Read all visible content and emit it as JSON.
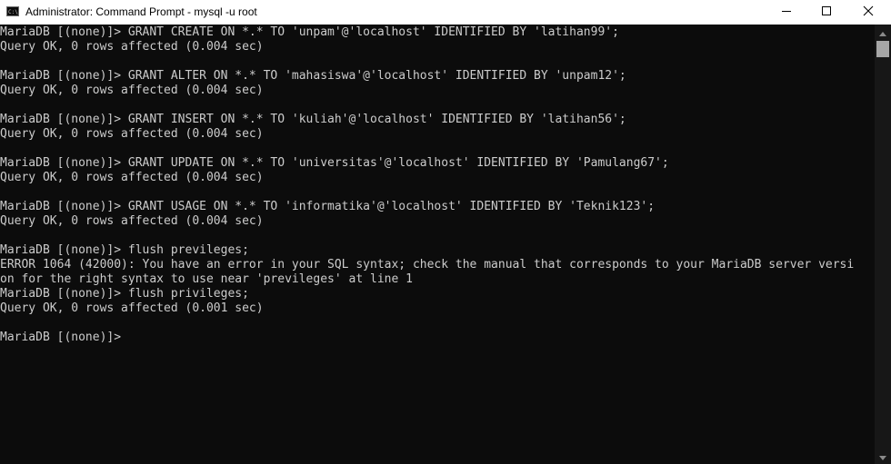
{
  "window": {
    "title": "Administrator: Command Prompt - mysql  -u root",
    "app_icon": "cmd-icon",
    "controls": [
      "minimize-icon",
      "maximize-icon",
      "close-icon"
    ]
  },
  "colors": {
    "console_background": "#0c0c0c",
    "console_text": "#cccccc",
    "titlebar_background": "#ffffff",
    "scrollbar_track": "#171717",
    "scrollbar_thumb": "#a6a6a6"
  },
  "console": {
    "lines": [
      "MariaDB [(none)]> GRANT CREATE ON *.* TO 'unpam'@'localhost' IDENTIFIED BY 'latihan99';",
      "Query OK, 0 rows affected (0.004 sec)",
      "",
      "MariaDB [(none)]> GRANT ALTER ON *.* TO 'mahasiswa'@'localhost' IDENTIFIED BY 'unpam12';",
      "Query OK, 0 rows affected (0.004 sec)",
      "",
      "MariaDB [(none)]> GRANT INSERT ON *.* TO 'kuliah'@'localhost' IDENTIFIED BY 'latihan56';",
      "Query OK, 0 rows affected (0.004 sec)",
      "",
      "MariaDB [(none)]> GRANT UPDATE ON *.* TO 'universitas'@'localhost' IDENTIFIED BY 'Pamulang67';",
      "Query OK, 0 rows affected (0.004 sec)",
      "",
      "MariaDB [(none)]> GRANT USAGE ON *.* TO 'informatika'@'localhost' IDENTIFIED BY 'Teknik123';",
      "Query OK, 0 rows affected (0.004 sec)",
      "",
      "MariaDB [(none)]> flush previleges;",
      "ERROR 1064 (42000): You have an error in your SQL syntax; check the manual that corresponds to your MariaDB server versi",
      "on for the right syntax to use near 'previleges' at line 1",
      "MariaDB [(none)]> flush privileges;",
      "Query OK, 0 rows affected (0.001 sec)",
      "",
      "MariaDB [(none)]>"
    ]
  },
  "scrollbar": {
    "up_icon": "scroll-up-arrow-icon",
    "down_icon": "scroll-down-arrow-icon"
  }
}
